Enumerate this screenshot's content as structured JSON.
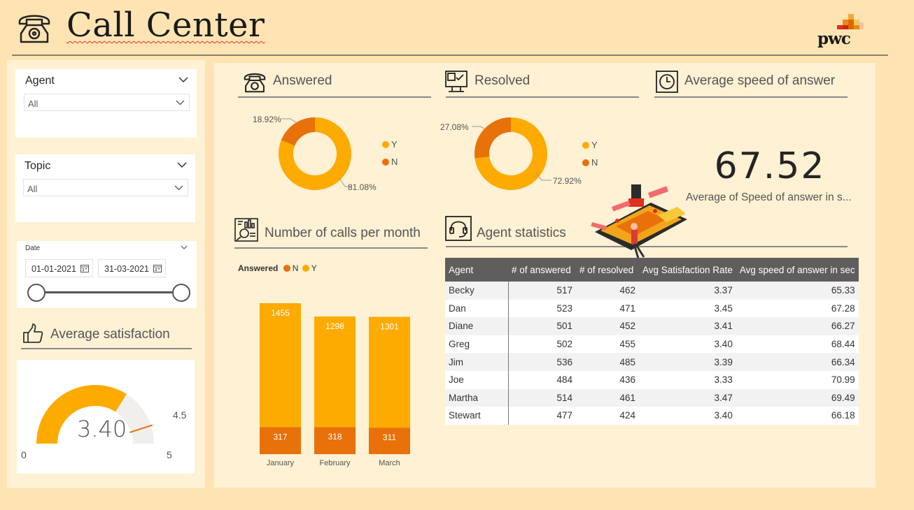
{
  "header": {
    "title": "Call Center",
    "logo_text": "pwc"
  },
  "filters": {
    "agent": {
      "label": "Agent",
      "value": "All"
    },
    "topic": {
      "label": "Topic",
      "value": "All"
    },
    "date": {
      "label": "Date",
      "start": "01-01-2021",
      "end": "31-03-2021"
    }
  },
  "satisfaction": {
    "title": "Average satisfaction",
    "value_label": "3.40",
    "value": 3.4,
    "min_label": "0",
    "max_label": "5",
    "target_label": "4.5",
    "min": 0,
    "max": 5,
    "target": 4.5
  },
  "answered": {
    "title": "Answered",
    "y_pct_label": "81.08%",
    "n_pct_label": "18.92%",
    "legend_y": "Y",
    "legend_n": "N"
  },
  "resolved": {
    "title": "Resolved",
    "y_pct_label": "72.92%",
    "n_pct_label": "27.08%",
    "legend_y": "Y",
    "legend_n": "N"
  },
  "speed": {
    "title": "Average speed of answer",
    "value": "67.52",
    "caption": "Average of Speed of answer in s..."
  },
  "calls_per_month": {
    "title": "Number of calls per month",
    "legend_title": "Answered",
    "legend_n": "N",
    "legend_y": "Y"
  },
  "agent_stats": {
    "title": "Agent statistics",
    "columns": [
      "Agent",
      "# of answered",
      "# of resolved",
      "Avg Satisfaction Rate",
      "Avg speed of answer in sec"
    ],
    "rows": [
      [
        "Becky",
        "517",
        "462",
        "3.37",
        "65.33"
      ],
      [
        "Dan",
        "523",
        "471",
        "3.45",
        "67.28"
      ],
      [
        "Diane",
        "501",
        "452",
        "3.41",
        "66.27"
      ],
      [
        "Greg",
        "502",
        "455",
        "3.40",
        "68.44"
      ],
      [
        "Jim",
        "536",
        "485",
        "3.39",
        "66.34"
      ],
      [
        "Joe",
        "484",
        "436",
        "3.33",
        "70.99"
      ],
      [
        "Martha",
        "514",
        "461",
        "3.47",
        "69.49"
      ],
      [
        "Stewart",
        "477",
        "424",
        "3.40",
        "66.18"
      ]
    ]
  },
  "colors": {
    "yes": "#fdab00",
    "no": "#e8710a",
    "background": "#fde4b2",
    "panel": "#fef1d4"
  },
  "chart_data": [
    {
      "type": "pie",
      "name": "Answered",
      "categories": [
        "Y",
        "N"
      ],
      "values": [
        81.08,
        18.92
      ]
    },
    {
      "type": "pie",
      "name": "Resolved",
      "categories": [
        "Y",
        "N"
      ],
      "values": [
        72.92,
        27.08
      ]
    },
    {
      "type": "bar",
      "stacked": true,
      "categories": [
        "January",
        "February",
        "March"
      ],
      "series": [
        {
          "name": "N",
          "values": [
            317,
            318,
            311
          ]
        },
        {
          "name": "Y",
          "values": [
            1455,
            1298,
            1301
          ]
        }
      ],
      "legend": "top-left",
      "grid": false
    }
  ]
}
